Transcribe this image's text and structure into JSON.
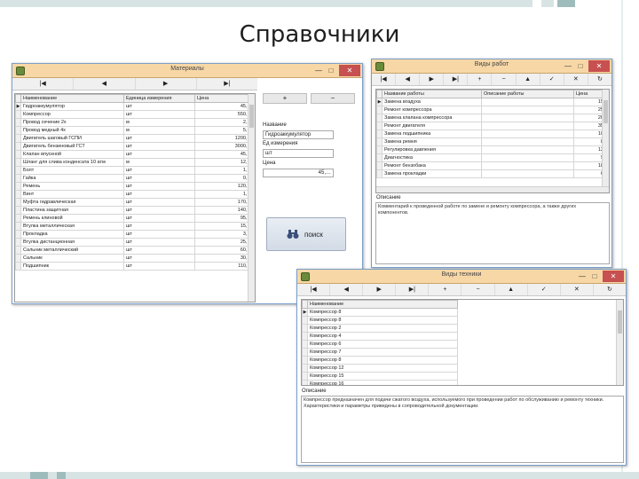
{
  "page_title": "Справочники",
  "colors": {
    "titlebar": "#f7d7a6",
    "close": "#c75050",
    "border": "#7a9fc9",
    "decor": "#d8e4e4"
  },
  "win_controls": {
    "min": "—",
    "max": "□",
    "close": "✕"
  },
  "materials": {
    "title": "Материалы",
    "nav": [
      "|◀",
      "◀",
      "▶",
      "▶|"
    ],
    "columns": [
      "Наименование",
      "Единица измерения",
      "Цена"
    ],
    "rows": [
      [
        "Гидроаккумулятор",
        "шт",
        "45,…"
      ],
      [
        "Компрессор",
        "шт",
        "550,…"
      ],
      [
        "Провод сечение 2х",
        "м",
        "2,…"
      ],
      [
        "Провод медный 4х",
        "м",
        "5,…"
      ],
      [
        "Двигатель шаговый ГСПИ",
        "шт",
        "1200,…"
      ],
      [
        "Двигатель бензиновый ГСТ",
        "шт",
        "3000,…"
      ],
      [
        "Клапан впускной",
        "шт",
        "45,…"
      ],
      [
        "Шланг для слива конденсата 10 атм",
        "м",
        "12,…"
      ],
      [
        "Болт",
        "шт",
        "1,…"
      ],
      [
        "Гайка",
        "шт",
        "0,…"
      ],
      [
        "Ремень",
        "шт",
        "120,…"
      ],
      [
        "Винт",
        "шт",
        "1,…"
      ],
      [
        "Муфта гидравлическая",
        "шт",
        "170,…"
      ],
      [
        "Пластина защитная",
        "шт",
        "140,…"
      ],
      [
        "Ремень клиновой",
        "шт",
        "95,…"
      ],
      [
        "Втулка металлическая",
        "шт",
        "15,…"
      ],
      [
        "Прокладка",
        "шт",
        "3,…"
      ],
      [
        "Втулка дистанционная",
        "шт",
        "25,…"
      ],
      [
        "Сальник металлический",
        "шт",
        "60,…"
      ],
      [
        "Сальник",
        "шт",
        "30,…"
      ],
      [
        "Подшипник",
        "шт",
        "110,…"
      ]
    ],
    "side_nav": [
      "+",
      "−"
    ],
    "field_name_label": "Название",
    "field_name_value": "Гидроаккумулятор",
    "field_unit_label": "Ед измерения",
    "field_unit_value": "шт",
    "field_price_label": "Цена",
    "field_price_value": "45,…",
    "search_label": "поиск"
  },
  "worktypes": {
    "title": "Виды работ",
    "nav": [
      "|◀",
      "◀",
      "▶",
      "▶|",
      "+",
      "−",
      "▲",
      "✓",
      "✕",
      "↻"
    ],
    "columns": [
      "Название работы",
      "Описание работы",
      "Цена"
    ],
    "rows": [
      [
        "Замена воздуха",
        "",
        "150"
      ],
      [
        "Ремонт компрессора",
        "",
        "250"
      ],
      [
        "Замена клапана компрессора",
        "",
        "200"
      ],
      [
        "Ремонт двигателя",
        "",
        "350"
      ],
      [
        "Замена подшипника",
        "",
        "100"
      ],
      [
        "Замена ремня",
        "",
        "80"
      ],
      [
        "Регулировка давления",
        "",
        "120"
      ],
      [
        "Диагностика",
        "",
        "90"
      ],
      [
        "Ремонт бензобака",
        "",
        "180"
      ],
      [
        "Замена прокладки",
        "",
        "60"
      ]
    ],
    "memo_label": "Описание",
    "memo_text": "Комментарий к проведенной работе по замене и ремонту компрессора, а также других компонентов."
  },
  "parts": {
    "title": "Виды техники",
    "nav": [
      "|◀",
      "◀",
      "▶",
      "▶|",
      "+",
      "−",
      "▲",
      "✓",
      "✕",
      "↻"
    ],
    "columns": [
      "Наименование"
    ],
    "rows": [
      "Компрессор 8",
      "Компрессор 8",
      "Компрессор 2",
      "Компрессор 4",
      "Компрессор 6",
      "Компрессор 7",
      "Компрессор 8",
      "Компрессор 12",
      "Компрессор 15",
      "Компрессор 16",
      "Компрессор 18"
    ],
    "memo_label": "Описание",
    "memo_text": "Компрессор предназначен для подачи сжатого воздуха, используемого при проведении работ по обслуживанию и ремонту техники. Характеристики и параметры приведены в сопроводительной документации."
  }
}
